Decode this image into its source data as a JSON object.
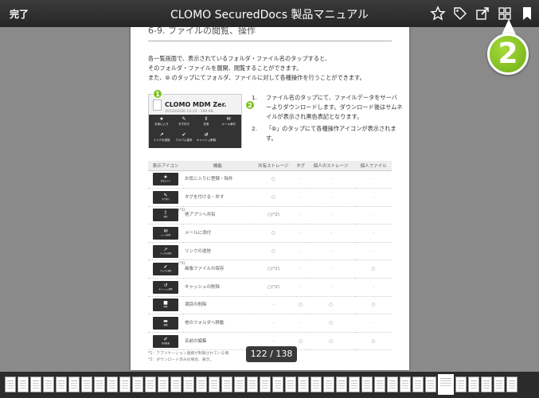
{
  "topbar": {
    "done_label": "完了",
    "title": "CLOMO SecuredDocs 製品マニュアル",
    "icons": [
      "star-icon",
      "tag-icon",
      "share-icon",
      "grid-icon",
      "bookmark-icon"
    ]
  },
  "page": {
    "section_title": "6-9. ファイルの閲覧、操作",
    "intro": [
      "各一覧画面で、表示されているフォルダ・ファイル名のタップすると、",
      "そのフォルダ・ファイルを展開、閲覧することができます。",
      "また、⦾ のタップにてフォルダ、ファイルに対して各種操作を行うことができます。"
    ],
    "screenshot": {
      "app_name": "CLOMO MDM Zer.",
      "meta": "2013/03/26 12:13 · 188 KB",
      "callouts": [
        "1",
        "2"
      ],
      "actions": [
        {
          "glyph": "★",
          "label": "お気に入り"
        },
        {
          "glyph": "✎",
          "label": "タグ付け"
        },
        {
          "glyph": "⇪",
          "label": "共有"
        },
        {
          "glyph": "✉",
          "label": "メール添付"
        },
        {
          "glyph": "↗",
          "label": "リンクの送信"
        },
        {
          "glyph": "✔",
          "label": "アルバム保存"
        },
        {
          "glyph": "↺",
          "label": "キャッシュ削除"
        }
      ]
    },
    "steps": [
      {
        "num": "1.",
        "text": "ファイル名のタップにて、ファイルデータをサーバーよりダウンロードします。ダウンロード後はサムネイルが表示され黒色表記となります。"
      },
      {
        "num": "2.",
        "text": "「⦾」のタップにて各種操作アイコンが表示されます。"
      }
    ],
    "table": {
      "headers": [
        "表示アイコン",
        "機能",
        "共有ストレージ",
        "タグ",
        "個人のストレージ",
        "個人ファイル"
      ],
      "rows": [
        {
          "glyph": "★",
          "icon_label": "お気に入り",
          "note": "",
          "func": "お気に入りに登録・除外",
          "cells": [
            "○",
            "-",
            "-",
            "-"
          ]
        },
        {
          "glyph": "✎",
          "icon_label": "タグ付け",
          "note": "",
          "func": "タグを付ける・外す",
          "cells": [
            "○",
            "-",
            "-",
            "-"
          ]
        },
        {
          "glyph": "⇪",
          "icon_label": "共有",
          "note": "(*1)",
          "func": "他アプリへ共有",
          "cells": [
            "○(*2)",
            "-",
            "-",
            "-"
          ]
        },
        {
          "glyph": "✉",
          "icon_label": "メール添付",
          "note": "",
          "func": "メールに添付",
          "cells": [
            "○",
            "-",
            "-",
            "-"
          ]
        },
        {
          "glyph": "↗",
          "icon_label": "リンクの送信",
          "note": "",
          "func": "リンクの送信",
          "cells": [
            "○",
            "-",
            "-",
            "-"
          ]
        },
        {
          "glyph": "✔",
          "icon_label": "アルバム保存",
          "note": "(*1)",
          "func": "画像ファイルの保存",
          "cells": [
            "○(*2)",
            "-",
            "-",
            "○"
          ]
        },
        {
          "glyph": "↺",
          "icon_label": "キャッシュ削除",
          "note": "",
          "func": "キャッシュの削除",
          "cells": [
            "○(*2)",
            "-",
            "-",
            "-"
          ]
        },
        {
          "glyph": "■",
          "icon_label": "削除",
          "note": "",
          "func": "項目の削除",
          "cells": [
            "-",
            "○",
            "○",
            "○"
          ]
        },
        {
          "glyph": "▬",
          "icon_label": "移動",
          "note": "",
          "func": "他のフォルダへ移動",
          "cells": [
            "-",
            "-",
            "○",
            "-"
          ]
        },
        {
          "glyph": "✐",
          "icon_label": "名前変更",
          "note": "",
          "func": "名前の編集",
          "cells": [
            "-",
            "○",
            "○",
            "○"
          ]
        }
      ]
    },
    "footnotes": [
      "*1：アプリケーション連携が制限されている場",
      "*2：ダウンロード済みの場合、表示。"
    ]
  },
  "page_counter": "122 / 138",
  "annotation_badge": "2",
  "thumbnail_strip": {
    "current_index": 34,
    "count": 40
  },
  "colors": {
    "accent_green": "#7cc220",
    "bar_dark": "#2b2b2b"
  }
}
